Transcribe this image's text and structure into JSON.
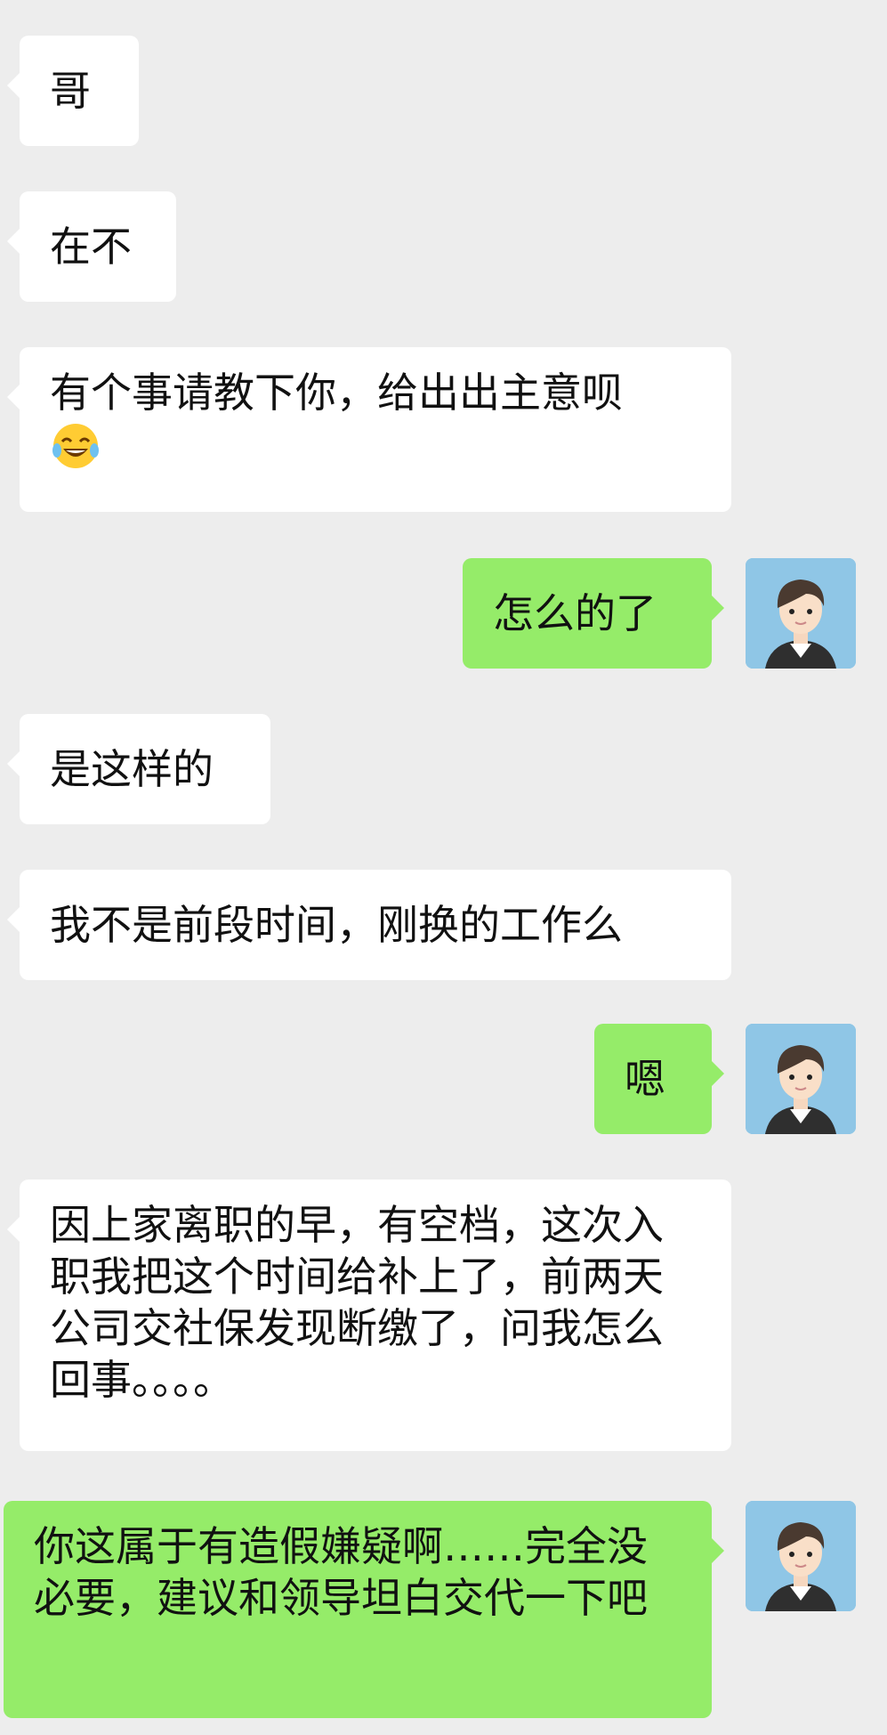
{
  "messages": [
    {
      "side": "in",
      "text": "哥"
    },
    {
      "side": "in",
      "text": "在不"
    },
    {
      "side": "in",
      "text": "有个事请教下你，给出出主意呗",
      "emoji": "grinning-tears-emoji"
    },
    {
      "side": "out",
      "text": "怎么的了"
    },
    {
      "side": "in",
      "text": "是这样的"
    },
    {
      "side": "in",
      "text": "我不是前段时间，刚换的工作么"
    },
    {
      "side": "out",
      "text": "嗯"
    },
    {
      "side": "in",
      "text": "因上家离职的早，有空档，这次入职我把这个时间给补上了，前两天公司交社保发现断缴了，问我怎么回事。。。。"
    },
    {
      "side": "out",
      "text": "你这属于有造假嫌疑啊……完全没必要，建议和领导坦白交代一下吧"
    }
  ],
  "colors": {
    "background": "#ededed",
    "incoming_bubble": "#ffffff",
    "outgoing_bubble": "#95ec69",
    "avatar_bg": "#8fc6e6"
  },
  "icons": {
    "avatar": "cartoon-man-avatar-icon",
    "emoji": "grinning-tears-emoji"
  }
}
